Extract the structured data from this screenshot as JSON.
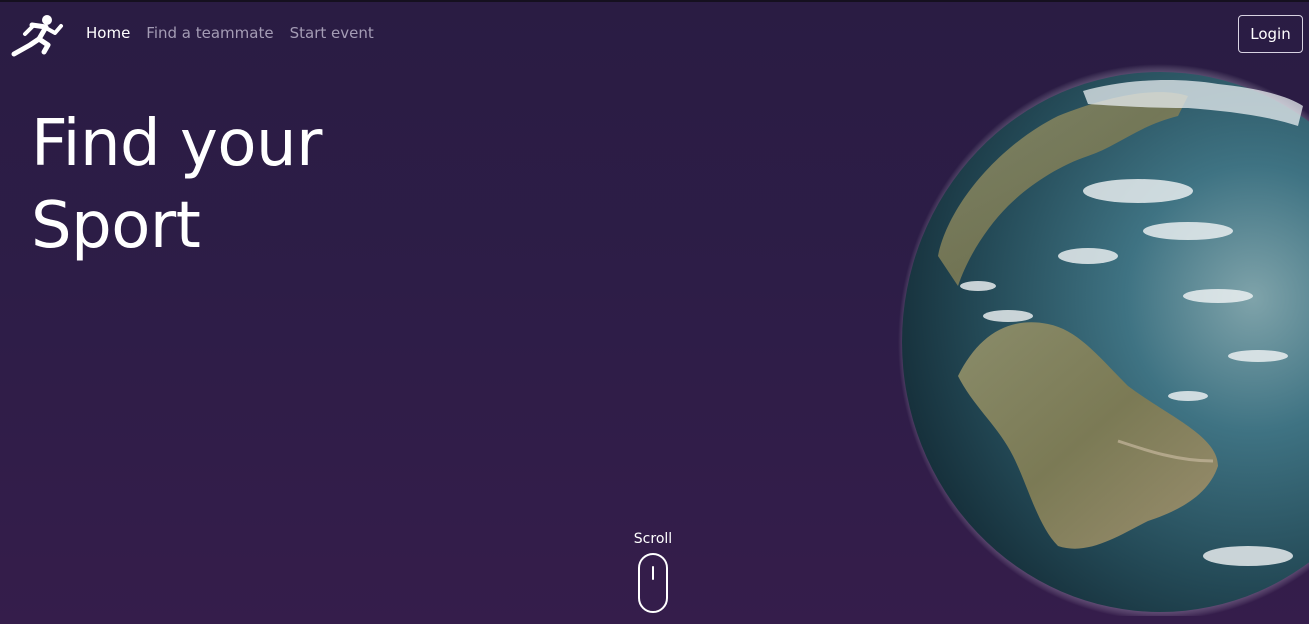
{
  "brand": {
    "logo_icon": "runner-icon"
  },
  "nav": {
    "items": [
      {
        "label": "Home",
        "active": true
      },
      {
        "label": "Find a teammate",
        "active": false
      },
      {
        "label": "Start event",
        "active": false
      }
    ],
    "login_label": "Login"
  },
  "hero": {
    "title_line1": "Find your",
    "title_line2": "Sport"
  },
  "scroll": {
    "label": "Scroll"
  },
  "colors": {
    "background": "#2d1d47",
    "nav_inactive": "#a49cb5",
    "text": "#ffffff",
    "ocean": "#3b6f7e"
  }
}
